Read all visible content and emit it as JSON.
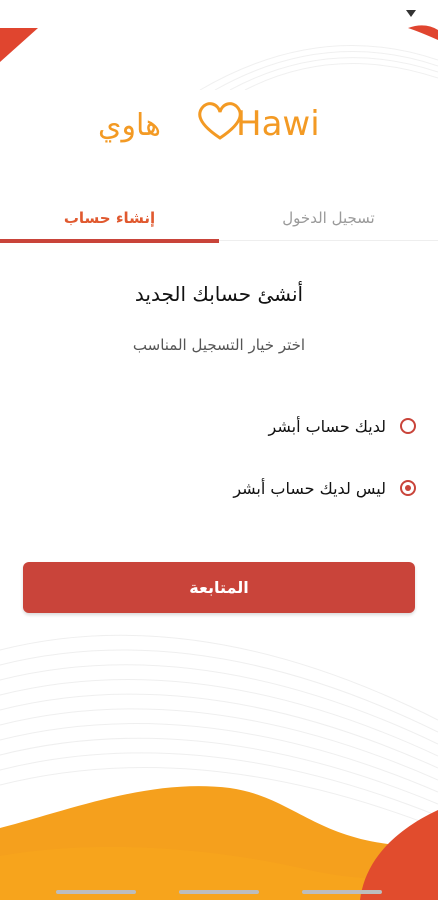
{
  "app": {
    "logo_text_ar": "هاوي",
    "logo_text_en": "Hawi"
  },
  "tabs": {
    "login_label": "تسجيل الدخول",
    "register_label": "إنشاء حساب",
    "active": "register"
  },
  "main": {
    "heading": "أنشئ حسابك الجديد",
    "subheading": "اختر خيار التسجيل المناسب",
    "options": [
      {
        "label": "لديك حساب أبشر",
        "selected": false
      },
      {
        "label": "ليس لديك حساب أبشر",
        "selected": true
      }
    ],
    "continue_label": "المتابعة"
  },
  "colors": {
    "brand_orange": "#f39a24",
    "accent_red": "#c9443a",
    "tab_active": "#e0592f"
  },
  "icons": {
    "status": "wifi-signal-icon",
    "logo": "heart-logo-icon"
  }
}
